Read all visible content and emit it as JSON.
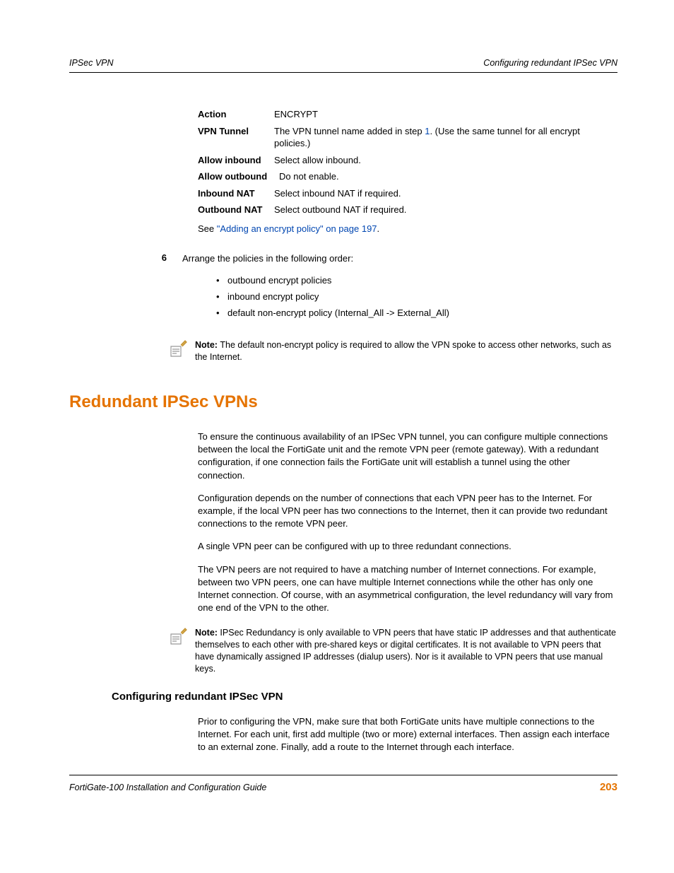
{
  "header": {
    "left": "IPSec VPN",
    "right": "Configuring redundant IPSec VPN"
  },
  "defs": {
    "action": {
      "label": "Action",
      "value": "ENCRYPT"
    },
    "vpn_tunnel": {
      "label": "VPN Tunnel",
      "v1": "The VPN tunnel name added in step ",
      "link": "1",
      "v2": ". (Use the same tunnel for all encrypt policies.)"
    },
    "allow_inbound": {
      "label": "Allow inbound",
      "value": "Select allow inbound."
    },
    "allow_outbound": {
      "label": "Allow outbound",
      "value": "Do not enable."
    },
    "inbound_nat": {
      "label": "Inbound NAT",
      "value": "Select inbound NAT if required."
    },
    "outbound_nat": {
      "label": "Outbound NAT",
      "value": "Select outbound NAT if required."
    }
  },
  "see": {
    "pre": "See ",
    "link": "\"Adding an encrypt policy\" on page 197",
    "post": "."
  },
  "step6": {
    "num": "6",
    "text": "Arrange the policies in the following order:",
    "bullets": {
      "b1": "outbound encrypt policies",
      "b2": "inbound encrypt policy",
      "b3": "default non-encrypt policy (Internal_All -> External_All)"
    }
  },
  "note1": {
    "label": "Note: ",
    "text": "The default non-encrypt policy is required to allow the VPN spoke to access other networks, such as the Internet."
  },
  "h1": "Redundant IPSec VPNs",
  "p1": "To ensure the continuous availability of an IPSec VPN tunnel, you can configure multiple connections between the local the FortiGate unit and the remote VPN peer (remote gateway). With a redundant configuration, if one connection fails the FortiGate unit will establish a tunnel using the other connection.",
  "p2": "Configuration depends on the number of connections that each VPN peer has to the Internet. For example, if the local VPN peer has two connections to the Internet, then it can provide two redundant connections to the remote VPN peer.",
  "p3": "A single VPN peer can be configured with up to three redundant connections.",
  "p4": "The VPN peers are not required to have a matching number of Internet connections. For example, between two VPN peers, one can have multiple Internet connections while the other has only one Internet connection. Of course, with an asymmetrical configuration, the level redundancy will vary from one end of the VPN to the other.",
  "note2": {
    "label": "Note: ",
    "text": "IPSec Redundancy is only available to VPN peers that have static IP addresses and that authenticate themselves to each other with pre-shared keys or digital certificates. It is not available to VPN peers that have dynamically assigned IP addresses (dialup users). Nor is it available to VPN peers that use manual keys."
  },
  "h2": "Configuring redundant IPSec VPN",
  "p5": "Prior to configuring the VPN, make sure that both FortiGate units have multiple connections to the Internet. For each unit, first add multiple (two or more) external interfaces. Then assign each interface to an external zone. Finally, add a route to the Internet through each interface.",
  "footer": {
    "left": "FortiGate-100 Installation and Configuration Guide",
    "right": "203"
  }
}
